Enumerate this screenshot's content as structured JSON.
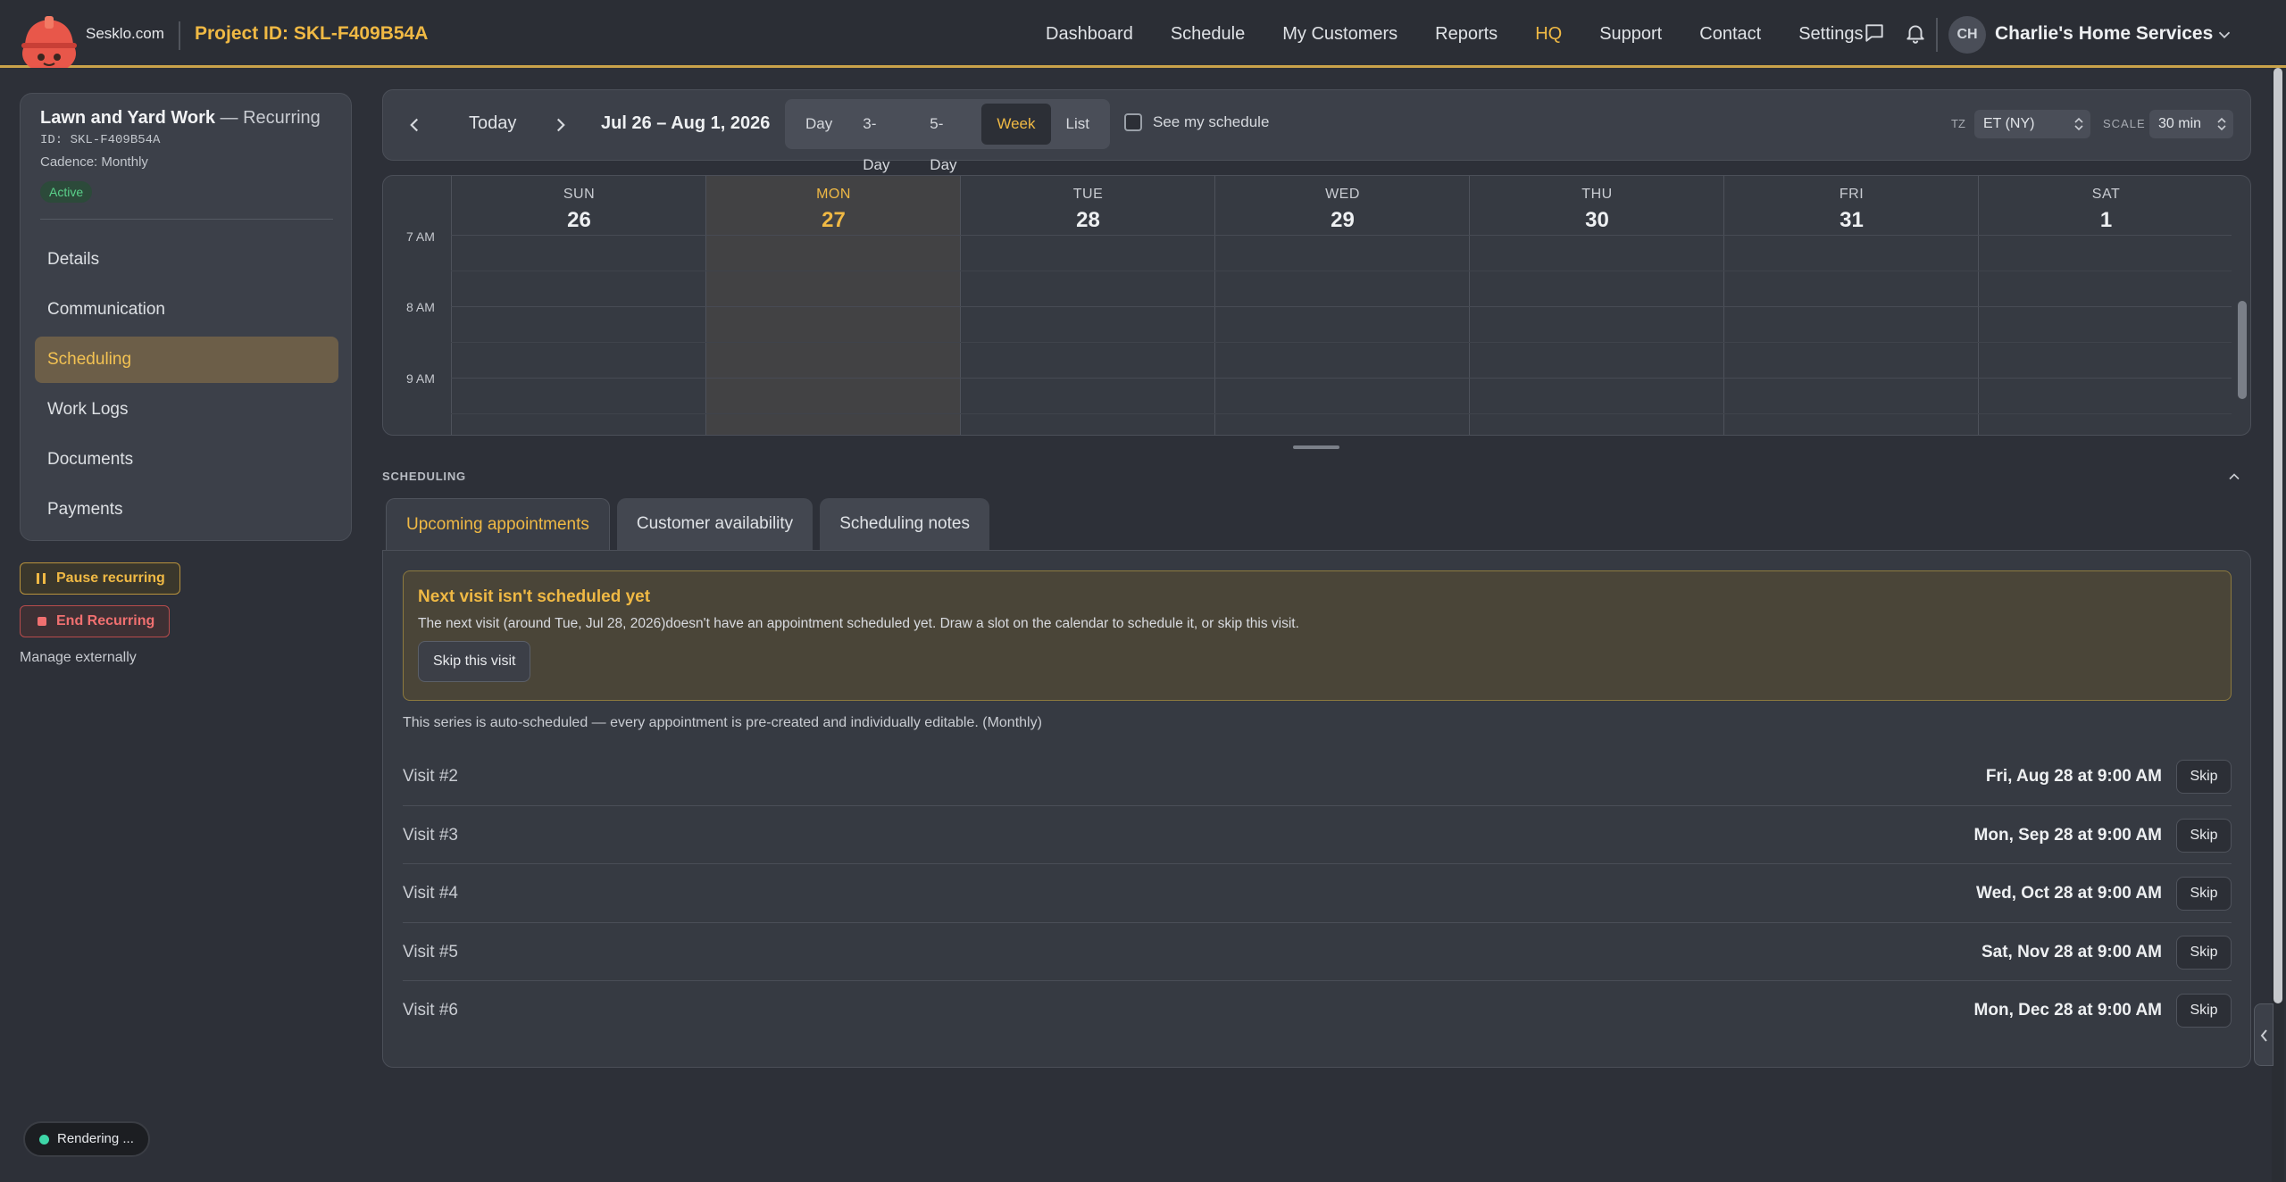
{
  "header": {
    "brand": "Sesklo.com",
    "project_id": "Project ID: SKL-F409B54A",
    "nav": [
      "Dashboard",
      "Schedule",
      "My Customers",
      "Reports",
      "HQ",
      "Support",
      "Contact",
      "Settings"
    ],
    "avatar_initials": "CH",
    "account_name": "Charlie's Home Services",
    "accent_color": "#f0b944"
  },
  "sidebar": {
    "title": "Lawn and Yard Work",
    "title_suffix": " — Recurring",
    "id": "ID: SKL-F409B54A",
    "cadence": "Cadence: Monthly",
    "status": "Active",
    "items": [
      {
        "label": "Details"
      },
      {
        "label": "Communication"
      },
      {
        "label": "Scheduling",
        "active": true
      },
      {
        "label": "Work Logs"
      },
      {
        "label": "Documents"
      },
      {
        "label": "Payments"
      }
    ],
    "pause_label": "Pause recurring",
    "end_label": "End Recurring",
    "manage_externally": "Manage externally"
  },
  "calendar": {
    "today_label": "Today",
    "range": "Jul 26 – Aug 1, 2026",
    "views": [
      "Day",
      "3-Day",
      "5-Day",
      "Week",
      "List"
    ],
    "active_view": "Week",
    "see_my_schedule": "See my schedule",
    "tz_label": "TZ",
    "tz_value": "ET (NY)",
    "scale_label": "SCALE",
    "scale_value": "30 min",
    "days": [
      {
        "name": "SUN",
        "num": "26"
      },
      {
        "name": "MON",
        "num": "27",
        "today": true
      },
      {
        "name": "TUE",
        "num": "28"
      },
      {
        "name": "WED",
        "num": "29"
      },
      {
        "name": "THU",
        "num": "30"
      },
      {
        "name": "FRI",
        "num": "31"
      },
      {
        "name": "SAT",
        "num": "1"
      }
    ],
    "time_labels": [
      "7 AM",
      "8 AM",
      "9 AM"
    ]
  },
  "scheduling": {
    "section_label": "SCHEDULING",
    "tabs": [
      "Upcoming appointments",
      "Customer availability",
      "Scheduling notes"
    ],
    "alert_title": "Next visit isn't scheduled yet",
    "alert_body": "The next visit (around Tue, Jul 28, 2026)doesn't have an appointment scheduled yet. Draw a slot on the calendar to schedule it, or skip this visit.",
    "alert_button": "Skip this visit",
    "series_note": "This series is auto-scheduled — every appointment is pre-created and individually editable. (Monthly)",
    "visits": [
      {
        "name": "Visit #2",
        "time": "Fri, Aug 28 at 9:00 AM",
        "action": "Skip"
      },
      {
        "name": "Visit #3",
        "time": "Mon, Sep 28 at 9:00 AM",
        "action": "Skip"
      },
      {
        "name": "Visit #4",
        "time": "Wed, Oct 28 at 9:00 AM",
        "action": "Skip"
      },
      {
        "name": "Visit #5",
        "time": "Sat, Nov 28 at 9:00 AM",
        "action": "Skip"
      },
      {
        "name": "Visit #6",
        "time": "Mon, Dec 28 at 9:00 AM",
        "action": "Skip"
      }
    ]
  },
  "status": {
    "rendering": "Rendering ..."
  }
}
